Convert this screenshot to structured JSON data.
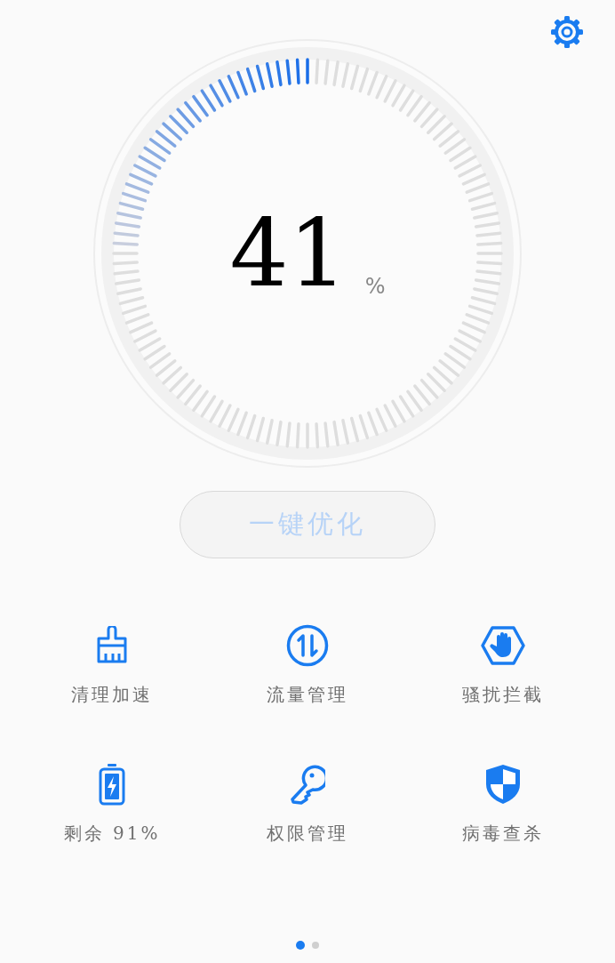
{
  "gauge": {
    "value": "41",
    "unit": "%"
  },
  "optimize_button": {
    "label": "一键优化"
  },
  "tools": [
    {
      "label": "清理加速"
    },
    {
      "label": "流量管理"
    },
    {
      "label": "骚扰拦截"
    },
    {
      "label": "剩余 91%"
    },
    {
      "label": "权限管理"
    },
    {
      "label": "病毒查杀"
    }
  ],
  "pager": [
    {
      "selected": true
    },
    {
      "selected": false
    }
  ]
}
